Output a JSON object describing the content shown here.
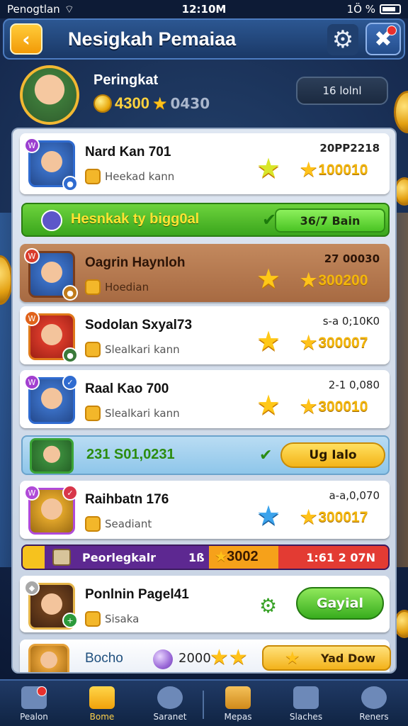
{
  "status": {
    "carrier": "Penogtlan",
    "time": "12:10M",
    "right": "1Ö  %"
  },
  "header": {
    "title": "Nesigkah Pemaiaa"
  },
  "profile": {
    "name": "Peringkat",
    "coins": "4300",
    "score": "0430",
    "button": "16 lolnl"
  },
  "rows": [
    {
      "name": "Nard Kan 701",
      "sub": "Heekad kann",
      "meta": "20PP2218",
      "points": "100010"
    },
    {
      "name": "Oagrin Haynloh",
      "sub": "Hoedian",
      "meta": "27 00030",
      "points": "300200"
    },
    {
      "name": "Sodolan Sxyal73",
      "sub": "Slealkari kann",
      "meta": "s-a 0;10K0",
      "points": "300007"
    },
    {
      "name": "Raal Kao 700",
      "sub": "Slealkari kann",
      "meta": "2-1 0,080",
      "points": "300010"
    },
    {
      "name": "Raihbatn 176",
      "sub": "Seadiant",
      "meta": "a-a,0,070",
      "points": "300017"
    },
    {
      "name": "Ponlnin Pagel41",
      "sub": "Sisaka",
      "button": "Gayial"
    }
  ],
  "highlight": {
    "text": "Hesnkak ty bigg0al",
    "pill": "36/7 Bain"
  },
  "blue_banner": {
    "value": "231 S01,0231",
    "pill": "Ug Ialo"
  },
  "purple_banner": {
    "label": "Peorlegkalr",
    "mid": "1ß",
    "points": "3002",
    "right": "1:61 2 07N"
  },
  "last_row": {
    "name": "Bocho",
    "num": "2000",
    "pill": "Yad Dow"
  },
  "nav": [
    {
      "label": "Pealon",
      "icon": "home-icon"
    },
    {
      "label": "Bome",
      "icon": "house-icon",
      "active": true
    },
    {
      "label": "Saranet",
      "icon": "ball-icon"
    },
    {
      "label": "Mepas",
      "icon": "map-icon"
    },
    {
      "label": "Slaches",
      "icon": "castle-icon"
    },
    {
      "label": "Reners",
      "icon": "profile-icon"
    }
  ]
}
